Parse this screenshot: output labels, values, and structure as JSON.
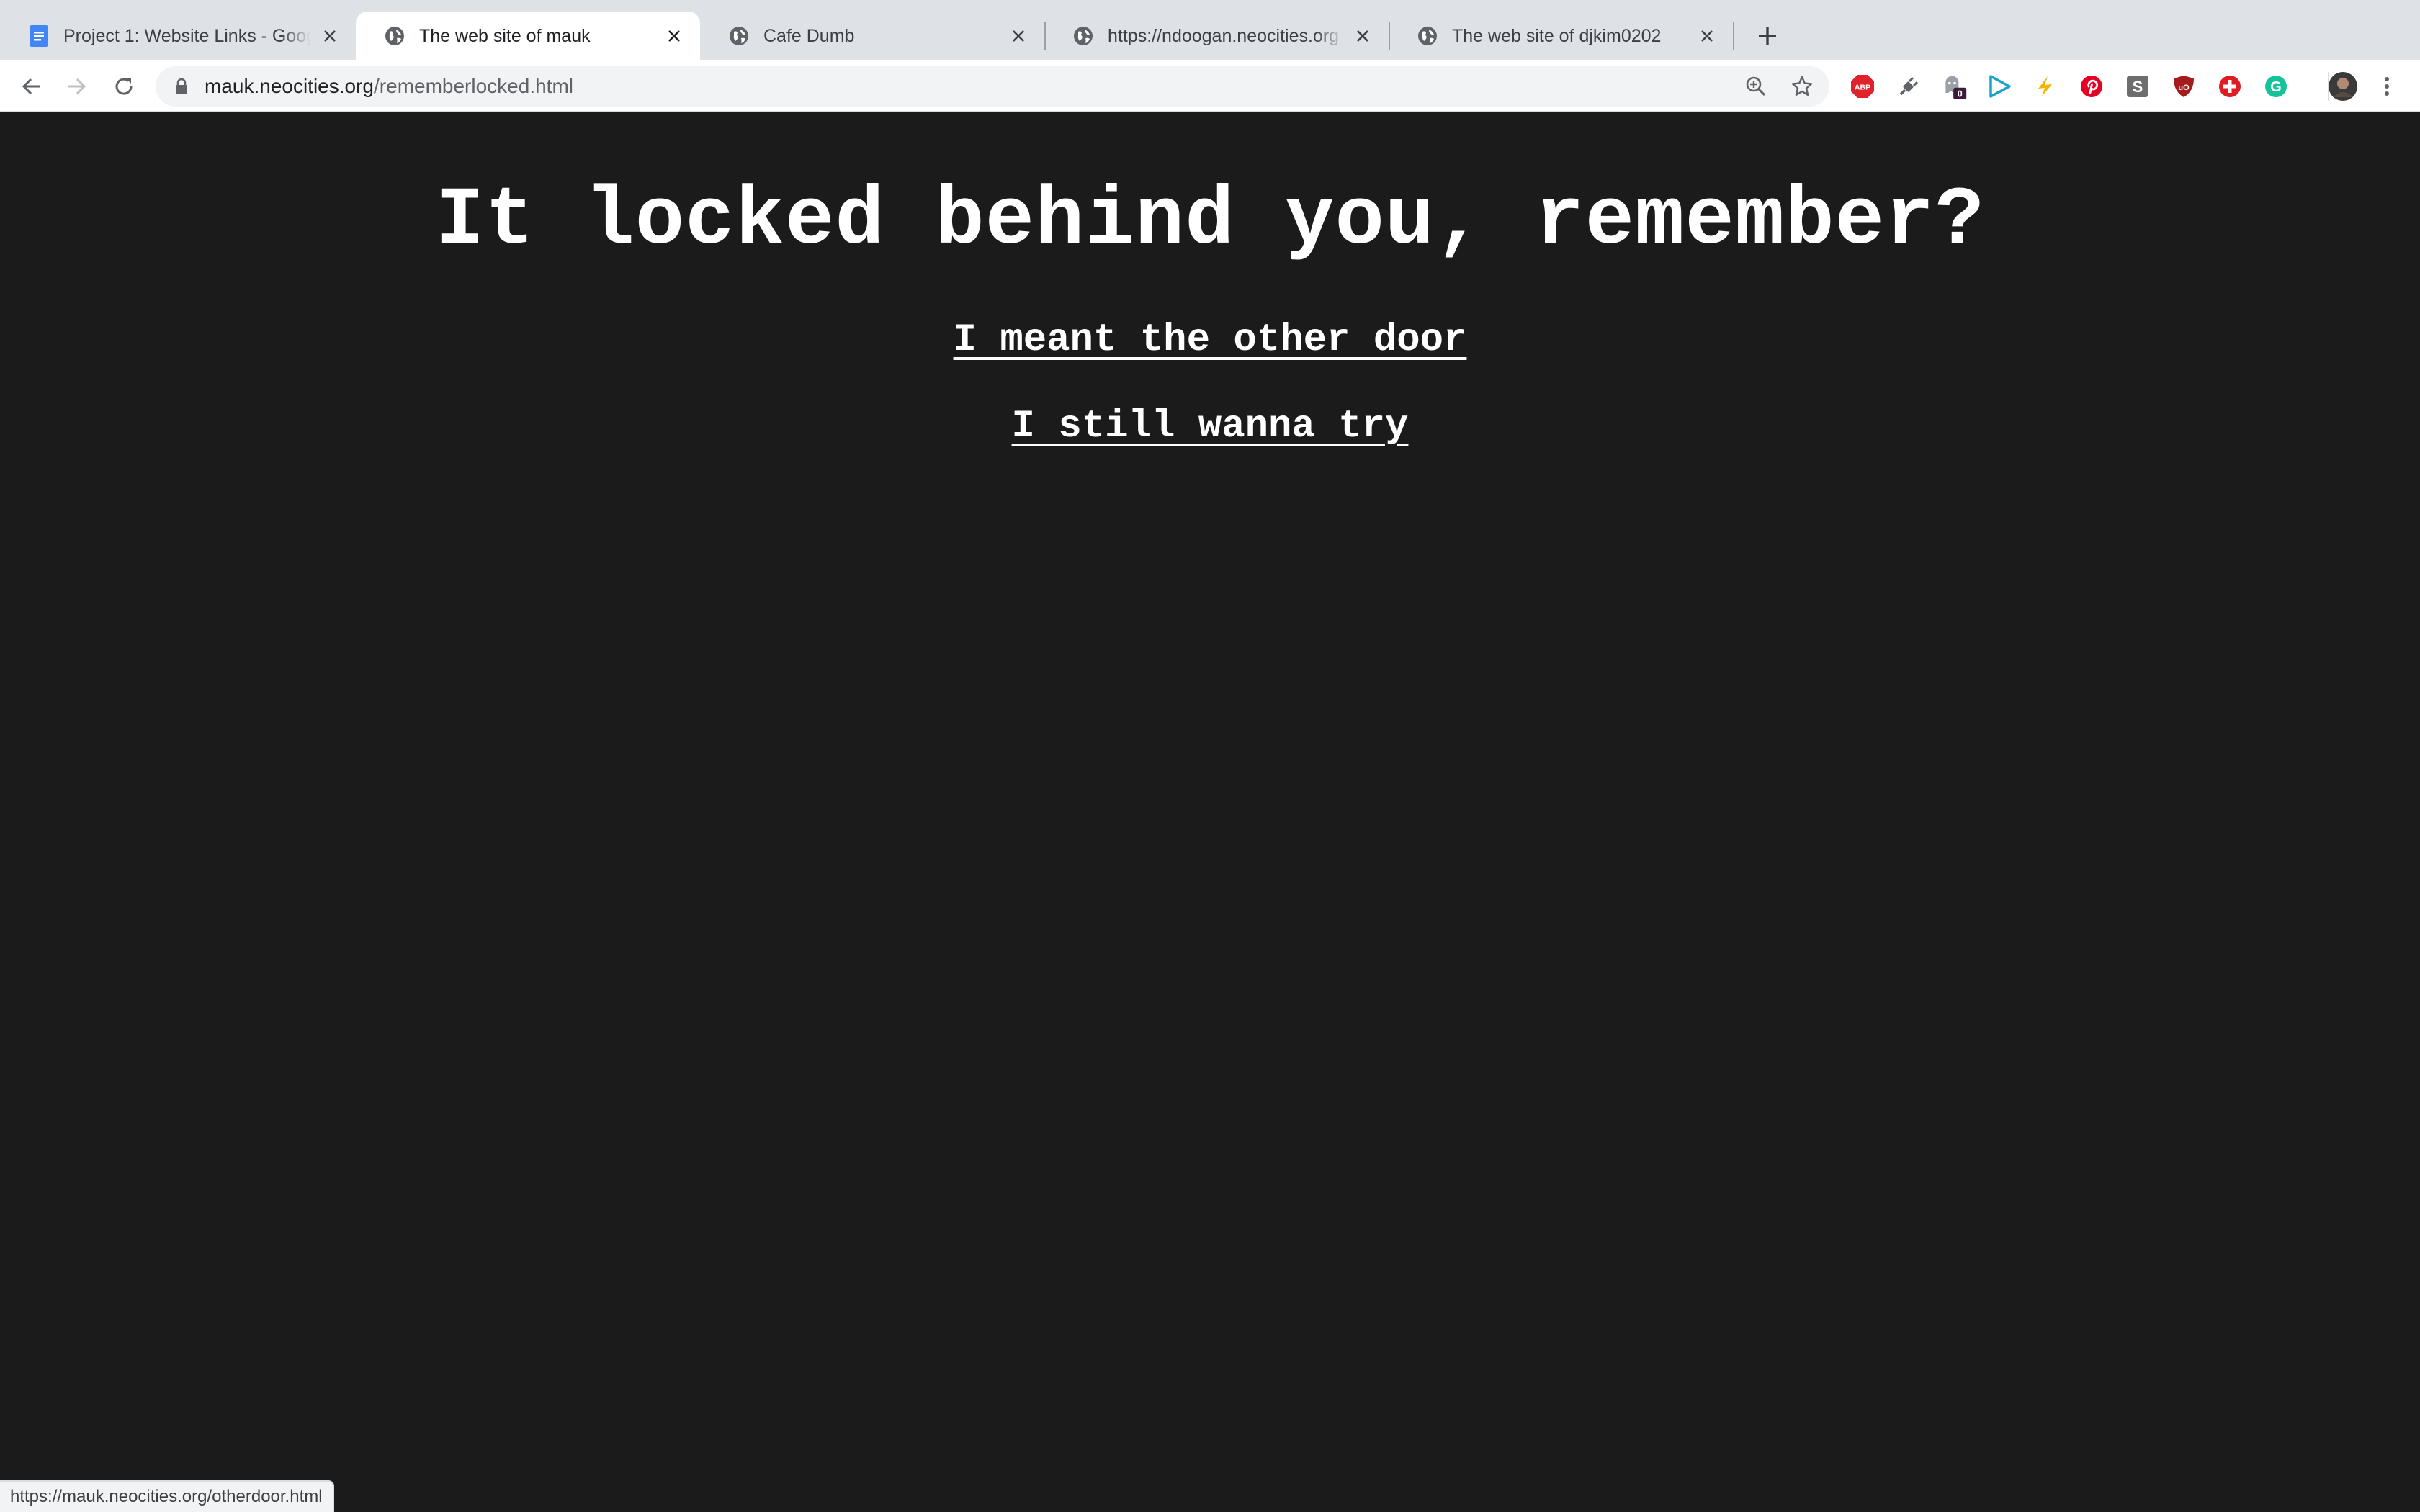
{
  "browser": {
    "tabs": [
      {
        "title": "Project 1: Website Links - Goog",
        "favicon": "google-docs-icon",
        "active": false
      },
      {
        "title": "The web site of mauk",
        "favicon": "globe-icon",
        "active": true
      },
      {
        "title": "Cafe Dumb",
        "favicon": "globe-icon",
        "active": false
      },
      {
        "title": "https://ndoogan.neocities.org",
        "favicon": "globe-icon",
        "active": false
      },
      {
        "title": "The web site of djkim0202",
        "favicon": "globe-icon",
        "active": false
      }
    ],
    "address_bar": {
      "host": "mauk.neocities.org",
      "path": "/rememberlocked.html"
    },
    "extensions": [
      {
        "name": "adblock-plus-icon",
        "label": "ABP",
        "color": "#e0232b"
      },
      {
        "name": "plug-icon",
        "label": "",
        "color": "#5f6368"
      },
      {
        "name": "ghostery-icon",
        "label": "0",
        "color": "#5f6368"
      },
      {
        "name": "play-arrow-icon",
        "label": "",
        "color": "#1aa3c7"
      },
      {
        "name": "sparkle-icon",
        "label": "",
        "color": "#f4b400"
      },
      {
        "name": "pinterest-icon",
        "label": "",
        "color": "#e60023"
      },
      {
        "name": "s-square-icon",
        "label": "S",
        "color": "#6d6d6d"
      },
      {
        "name": "ublock-icon",
        "label": "uO",
        "color": "#a51c1c"
      },
      {
        "name": "red-plus-icon",
        "label": "",
        "color": "#e11b22"
      },
      {
        "name": "grammarly-icon",
        "label": "G",
        "color": "#15c39a"
      }
    ]
  },
  "page": {
    "heading": "It locked behind you, remember?",
    "links": [
      "I meant the other door",
      "I still wanna try"
    ],
    "background": "#1b1b1b",
    "text_color": "#ffffff"
  },
  "status_bar": {
    "url": "https://mauk.neocities.org/otherdoor.html"
  }
}
